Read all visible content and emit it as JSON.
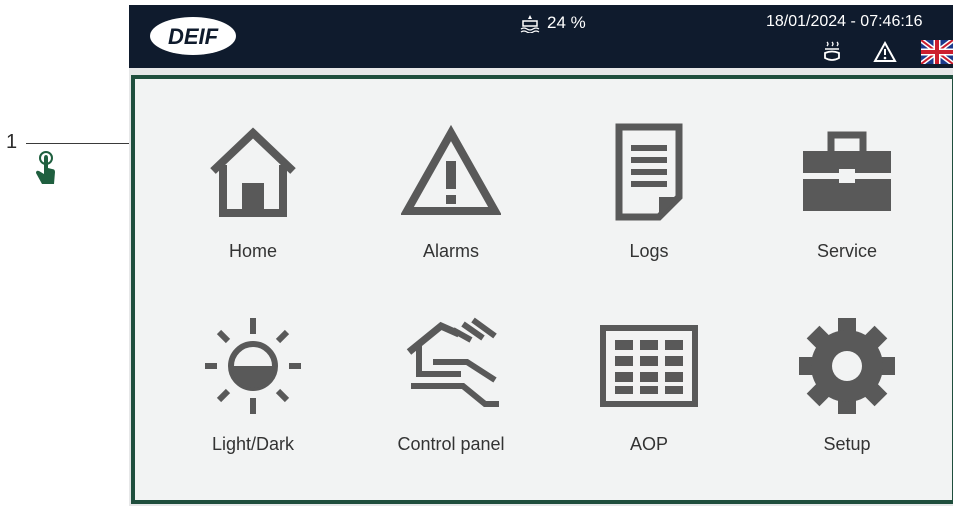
{
  "callout": {
    "number": "1",
    "icon": "touch-hand-icon"
  },
  "topbar": {
    "logo": "DEIF",
    "fuel_icon": "fuel-tank-icon",
    "fuel_level": "24 %",
    "datetime": "18/01/2024 - 07:46:16",
    "status_icons": [
      "heater-icon",
      "warning-triangle-icon",
      "uk-flag-icon"
    ]
  },
  "menu": {
    "items": [
      {
        "label": "Home",
        "icon": "home-icon"
      },
      {
        "label": "Alarms",
        "icon": "alarm-triangle-icon"
      },
      {
        "label": "Logs",
        "icon": "logs-document-icon"
      },
      {
        "label": "Service",
        "icon": "toolbox-icon"
      },
      {
        "label": "Light/Dark",
        "icon": "brightness-icon"
      },
      {
        "label": "Control panel",
        "icon": "hand-control-icon"
      },
      {
        "label": "AOP",
        "icon": "keypad-grid-icon"
      },
      {
        "label": "Setup",
        "icon": "gear-icon"
      }
    ]
  },
  "colors": {
    "topbar": "#0f1b2d",
    "panel_border": "#1f4e3d",
    "icon": "#595959",
    "callout_icon": "#1f5f3f"
  }
}
